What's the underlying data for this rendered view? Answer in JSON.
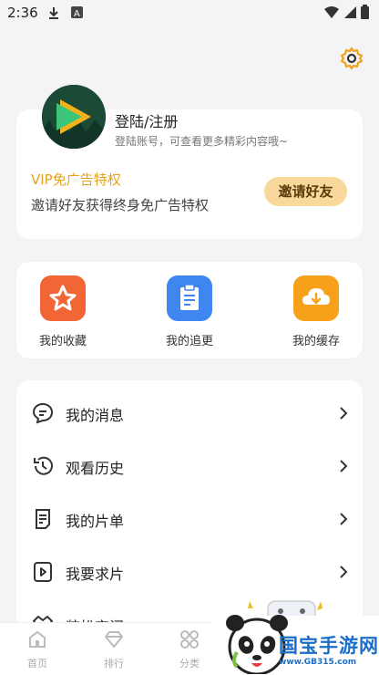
{
  "status": {
    "time": "2:36"
  },
  "profile": {
    "login_title": "登陆/注册",
    "login_subtitle": "登陆账号，可查看更多精彩内容哦~",
    "vip_title": "VIP免广告特权",
    "vip_subtitle": "邀请好友获得终身免广告特权",
    "invite_label": "邀请好友"
  },
  "quick": [
    {
      "label": "我的收藏",
      "icon": "star-icon",
      "color": "#f26535"
    },
    {
      "label": "我的追更",
      "icon": "clipboard-icon",
      "color": "#3f86f0"
    },
    {
      "label": "我的缓存",
      "icon": "download-cloud-icon",
      "color": "#f7a11b"
    }
  ],
  "menu": [
    {
      "label": "我的消息",
      "icon": "message-icon"
    },
    {
      "label": "观看历史",
      "icon": "history-icon"
    },
    {
      "label": "我的片单",
      "icon": "list-icon"
    },
    {
      "label": "我要求片",
      "icon": "video-request-icon"
    },
    {
      "label": "装扮空间",
      "icon": "dress-icon"
    }
  ],
  "tabs": [
    {
      "label": "首页",
      "icon": "home-icon"
    },
    {
      "label": "排行",
      "icon": "diamond-icon"
    },
    {
      "label": "分类",
      "icon": "grid-icon"
    }
  ],
  "watermark": {
    "text": "国宝手游网",
    "url": "www.GB315.com"
  }
}
